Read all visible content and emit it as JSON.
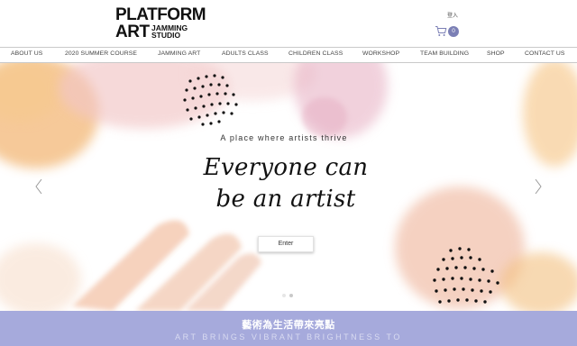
{
  "brand": {
    "line1": "PLATFORM",
    "line2": "ART",
    "sub1": "JAMMING",
    "sub2": "STUDIO"
  },
  "header": {
    "login_label": "登入",
    "cart_count": "0",
    "cart_icon": "cart-icon",
    "accent_color": "#7b7fb5"
  },
  "nav": {
    "items": [
      {
        "label": "ABOUT US"
      },
      {
        "label": "2020 SUMMER COURSE"
      },
      {
        "label": "JAMMING ART"
      },
      {
        "label": "ADULTS CLASS"
      },
      {
        "label": "CHILDREN CLASS"
      },
      {
        "label": "WORKSHOP"
      },
      {
        "label": "TEAM BUILDING"
      },
      {
        "label": "SHOP"
      },
      {
        "label": "CONTACT US"
      }
    ]
  },
  "hero": {
    "tagline": "A place where artists thrive",
    "headline_line1": "Everyone can",
    "headline_line2": "be an artist",
    "enter_label": "Enter",
    "prev_icon": "chevron-left-icon",
    "next_icon": "chevron-right-icon",
    "slide_count": 2,
    "active_slide": 1
  },
  "strip": {
    "title": "藝術為生活帶來亮點",
    "subtitle": "ART BRINGS VIBRANT BRIGHTNESS TO",
    "background": "#a6aadc"
  }
}
